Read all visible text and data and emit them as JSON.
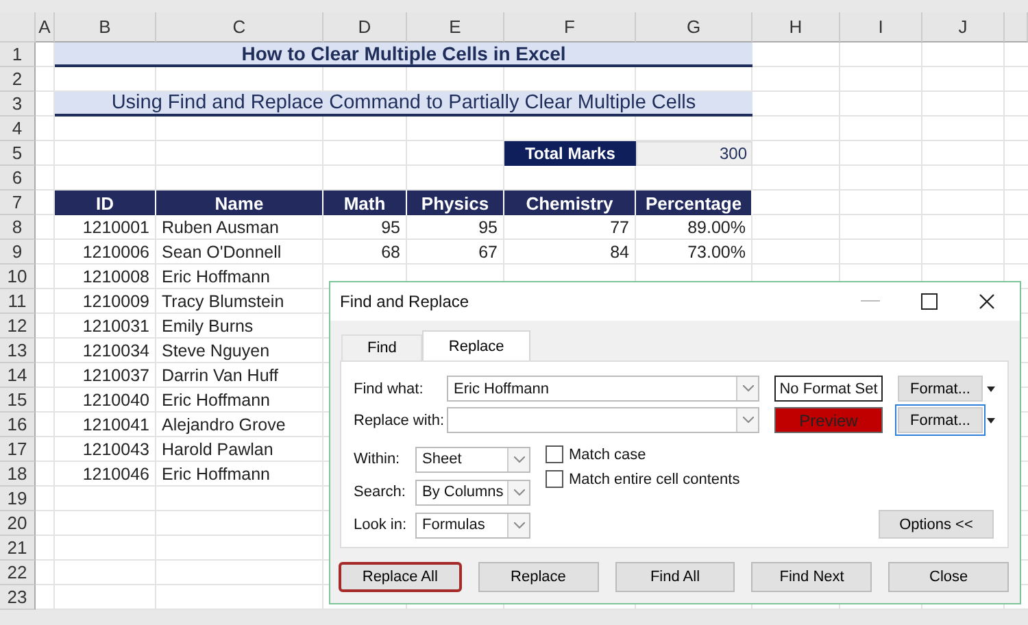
{
  "sheet": {
    "column_headers": [
      "A",
      "B",
      "C",
      "D",
      "E",
      "F",
      "G",
      "H",
      "I",
      "J"
    ],
    "row_numbers": [
      "1",
      "2",
      "3",
      "4",
      "5",
      "6",
      "7",
      "8",
      "9",
      "10",
      "11",
      "12",
      "13",
      "14",
      "15",
      "16",
      "17",
      "18",
      "19",
      "20",
      "21",
      "22",
      "23"
    ],
    "title": "How to Clear Multiple Cells in Excel",
    "subtitle": "Using Find and Replace Command to Partially Clear Multiple Cells",
    "total_marks": {
      "label": "Total Marks",
      "value": "300"
    },
    "table": {
      "columns": [
        "ID",
        "Name",
        "Math",
        "Physics",
        "Chemistry",
        "Percentage"
      ],
      "rows": [
        [
          "1210001",
          "Ruben Ausman",
          "95",
          "95",
          "77",
          "89.00%"
        ],
        [
          "1210006",
          "Sean O'Donnell",
          "68",
          "67",
          "84",
          "73.00%"
        ],
        [
          "1210008",
          "Eric Hoffmann"
        ],
        [
          "1210009",
          "Tracy Blumstein"
        ],
        [
          "1210031",
          "Emily Burns"
        ],
        [
          "1210034",
          "Steve Nguyen"
        ],
        [
          "1210037",
          "Darrin Van Huff"
        ],
        [
          "1210040",
          "Eric Hoffmann"
        ],
        [
          "1210041",
          "Alejandro Grove"
        ],
        [
          "1210043",
          "Harold Pawlan"
        ],
        [
          "1210046",
          "Eric Hoffmann"
        ]
      ]
    }
  },
  "dialog": {
    "title": "Find and Replace",
    "tabs": [
      {
        "label": "Find",
        "selected": false
      },
      {
        "label": "Replace",
        "selected": true
      }
    ],
    "find_what": {
      "label": "Find what:",
      "value": "Eric Hoffmann",
      "format_preview": "No Format Set",
      "format_button": "Format..."
    },
    "replace_with": {
      "label": "Replace with:",
      "format_preview": "Preview",
      "format_button": "Format..."
    },
    "options": [
      {
        "label": "Within:",
        "value": "Sheet"
      },
      {
        "label": "Search:",
        "value": "By Columns"
      },
      {
        "label": "Look in:",
        "value": "Formulas"
      }
    ],
    "checkboxes": [
      {
        "label": "Match case",
        "checked": false
      },
      {
        "label": "Match entire cell contents",
        "checked": false
      }
    ],
    "options_button": "Options <<",
    "buttons": [
      {
        "label": "Replace All",
        "highlighted": true
      },
      {
        "label": "Replace",
        "highlighted": false
      },
      {
        "label": "Find All",
        "highlighted": false
      },
      {
        "label": "Find Next",
        "highlighted": false
      },
      {
        "label": "Close",
        "highlighted": false
      }
    ]
  }
}
